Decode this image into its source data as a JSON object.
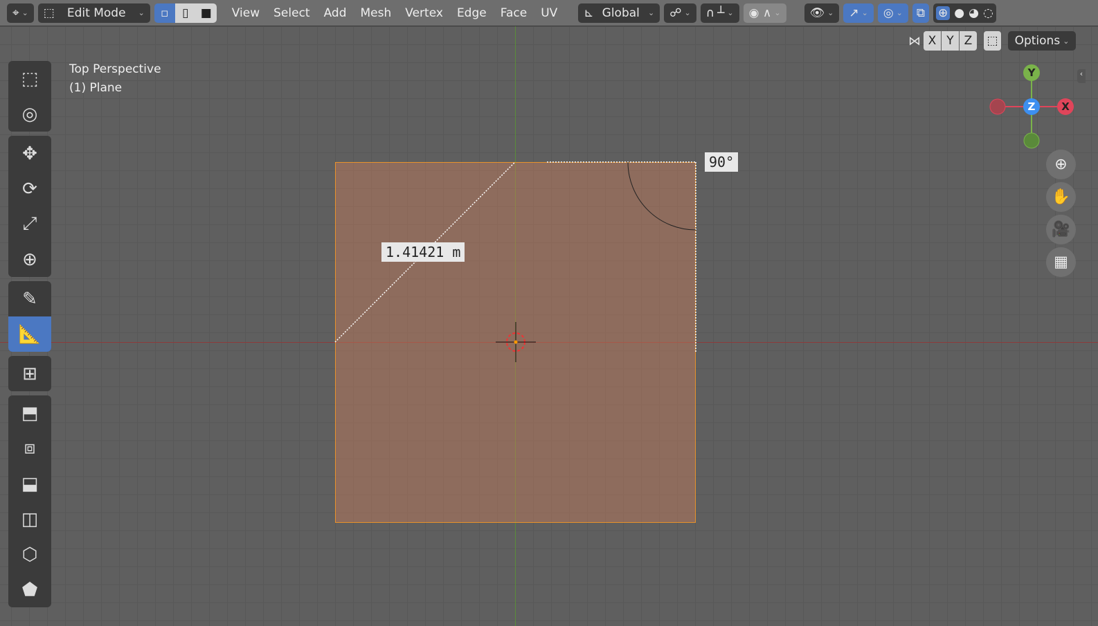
{
  "header": {
    "mode": "Edit Mode",
    "menus": [
      "View",
      "Select",
      "Add",
      "Mesh",
      "Vertex",
      "Edge",
      "Face",
      "UV"
    ],
    "orientation": "Global"
  },
  "subheader": {
    "axes": [
      "X",
      "Y",
      "Z"
    ],
    "options": "Options"
  },
  "overlay": {
    "view_name": "Top Perspective",
    "object": "(1) Plane"
  },
  "measure": {
    "length": "1.41421 m",
    "angle": "90°"
  },
  "gizmo": {
    "y": "Y",
    "x": "X",
    "z": "Z"
  },
  "colors": {
    "accent": "#4b78c2",
    "plane_edge": "#e8922a"
  }
}
